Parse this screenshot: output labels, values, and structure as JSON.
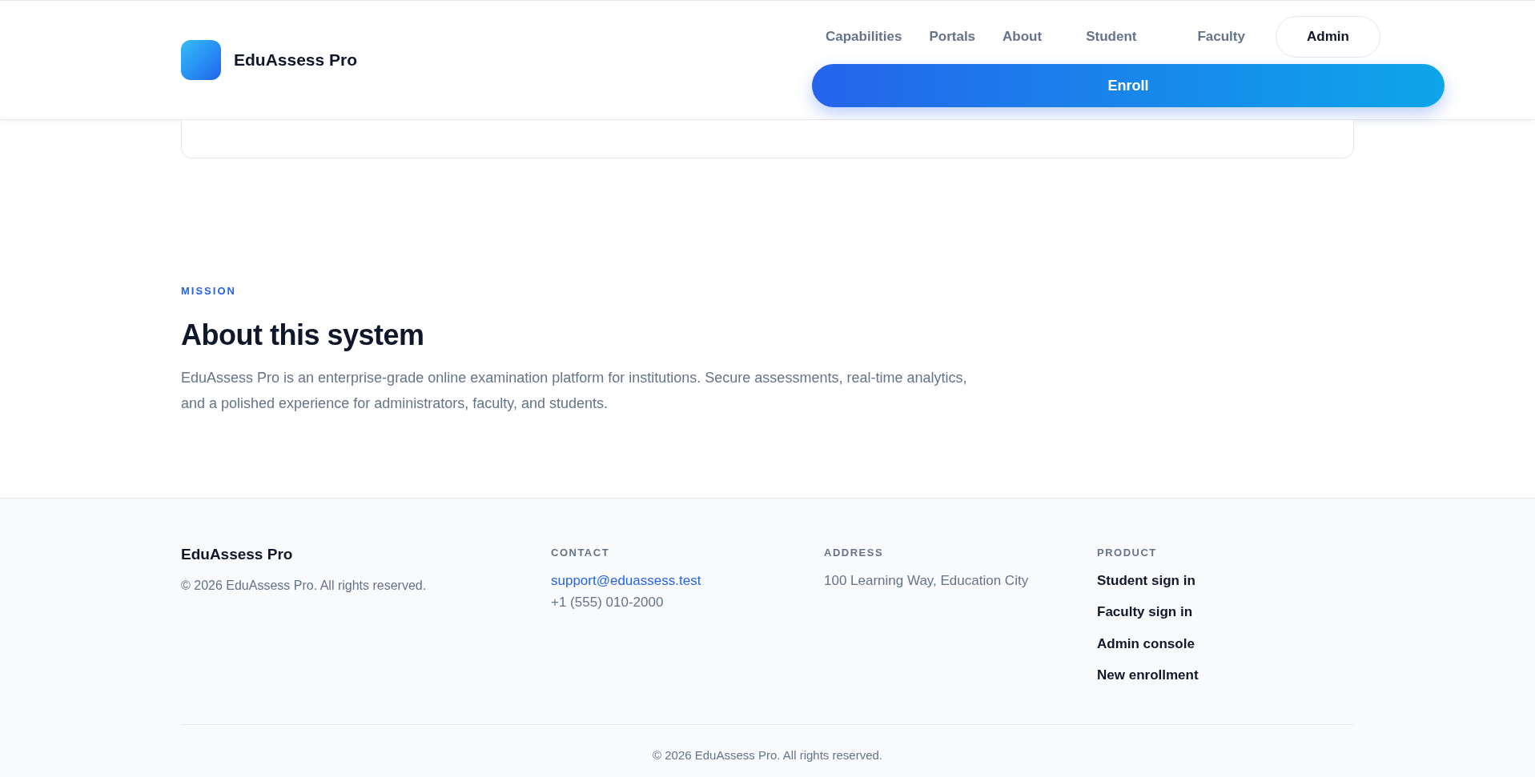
{
  "brand": {
    "name": "EduAssess Pro"
  },
  "nav": [
    {
      "label": "Capabilities",
      "kind": "link",
      "selected": false
    },
    {
      "label": "Portals",
      "kind": "link",
      "selected": false
    },
    {
      "label": "About",
      "kind": "link",
      "selected": false
    },
    {
      "label": "Student",
      "kind": "button",
      "selected": false
    },
    {
      "label": "Faculty",
      "kind": "button",
      "selected": false
    },
    {
      "label": "Admin",
      "kind": "button",
      "selected": true
    }
  ],
  "enroll_button": "Enroll",
  "mission": {
    "eyebrow": "MISSION",
    "title": "About this system",
    "body": "EduAssess Pro is an enterprise-grade online examination platform for institutions. Secure assessments, real-time analytics, and a polished experience for administrators, faculty, and students."
  },
  "footer": {
    "brand": "EduAssess Pro",
    "copyright": "© 2026 EduAssess Pro. All rights reserved.",
    "contact": {
      "heading": "CONTACT",
      "email": "support@eduassess.test",
      "phone": "+1 (555) 010-2000"
    },
    "address": {
      "heading": "ADDRESS",
      "text": "100 Learning Way, Education City"
    },
    "product": {
      "heading": "PRODUCT",
      "links": [
        "Student sign in",
        "Faculty sign in",
        "Admin console",
        "New enrollment"
      ]
    },
    "bottom": "© 2026 EduAssess Pro. All rights reserved."
  }
}
